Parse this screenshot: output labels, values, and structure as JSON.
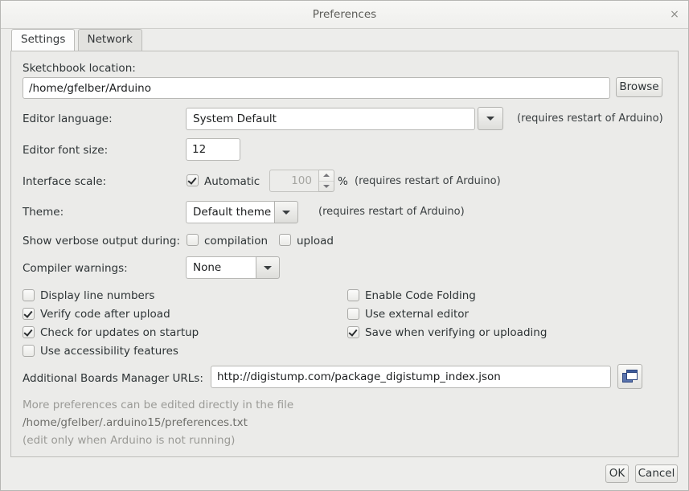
{
  "window": {
    "title": "Preferences",
    "close_icon": "close-icon",
    "close_glyph": "×"
  },
  "tabs": [
    {
      "label": "Settings",
      "active": true
    },
    {
      "label": "Network",
      "active": false
    }
  ],
  "settings": {
    "sketchbook": {
      "label": "Sketchbook location:",
      "value": "/home/gfelber/Arduino",
      "browse_label": "Browse"
    },
    "editor_language": {
      "label": "Editor language:",
      "value": "System Default",
      "note": "(requires restart of Arduino)"
    },
    "editor_font_size": {
      "label": "Editor font size:",
      "value": "12"
    },
    "interface_scale": {
      "label": "Interface scale:",
      "automatic_label": "Automatic",
      "automatic_checked": true,
      "value": "100",
      "unit": "%",
      "note": "(requires restart of Arduino)"
    },
    "theme": {
      "label": "Theme:",
      "value": "Default theme",
      "note": "(requires restart of Arduino)"
    },
    "verbose": {
      "label": "Show verbose output during:",
      "compilation_label": "compilation",
      "compilation_checked": false,
      "upload_label": "upload",
      "upload_checked": false
    },
    "compiler_warnings": {
      "label": "Compiler warnings:",
      "value": "None"
    },
    "checkboxes_left": [
      {
        "label": "Display line numbers",
        "checked": false
      },
      {
        "label": "Verify code after upload",
        "checked": true
      },
      {
        "label": "Check for updates on startup",
        "checked": true
      },
      {
        "label": "Use accessibility features",
        "checked": false
      }
    ],
    "checkboxes_right": [
      {
        "label": "Enable Code Folding",
        "checked": false
      },
      {
        "label": "Use external editor",
        "checked": false
      },
      {
        "label": "Save when verifying or uploading",
        "checked": true
      }
    ],
    "boards_urls": {
      "label": "Additional Boards Manager URLs:",
      "value": "http://digistump.com/package_digistump_index.json",
      "icon": "window-copy-icon"
    },
    "info": {
      "line1": "More preferences can be edited directly in the file",
      "line2": "/home/gfelber/.arduino15/preferences.txt",
      "line3": "(edit only when Arduino is not running)"
    }
  },
  "footer": {
    "ok_label": "OK",
    "cancel_label": "Cancel"
  },
  "colors": {
    "window_bg": "#ededeb",
    "panel_bg": "#ebebe9",
    "field_bg": "#ffffff",
    "text": "#2e3436",
    "muted_text": "#9a9a96",
    "icon_blue": "#3d5a9b"
  }
}
